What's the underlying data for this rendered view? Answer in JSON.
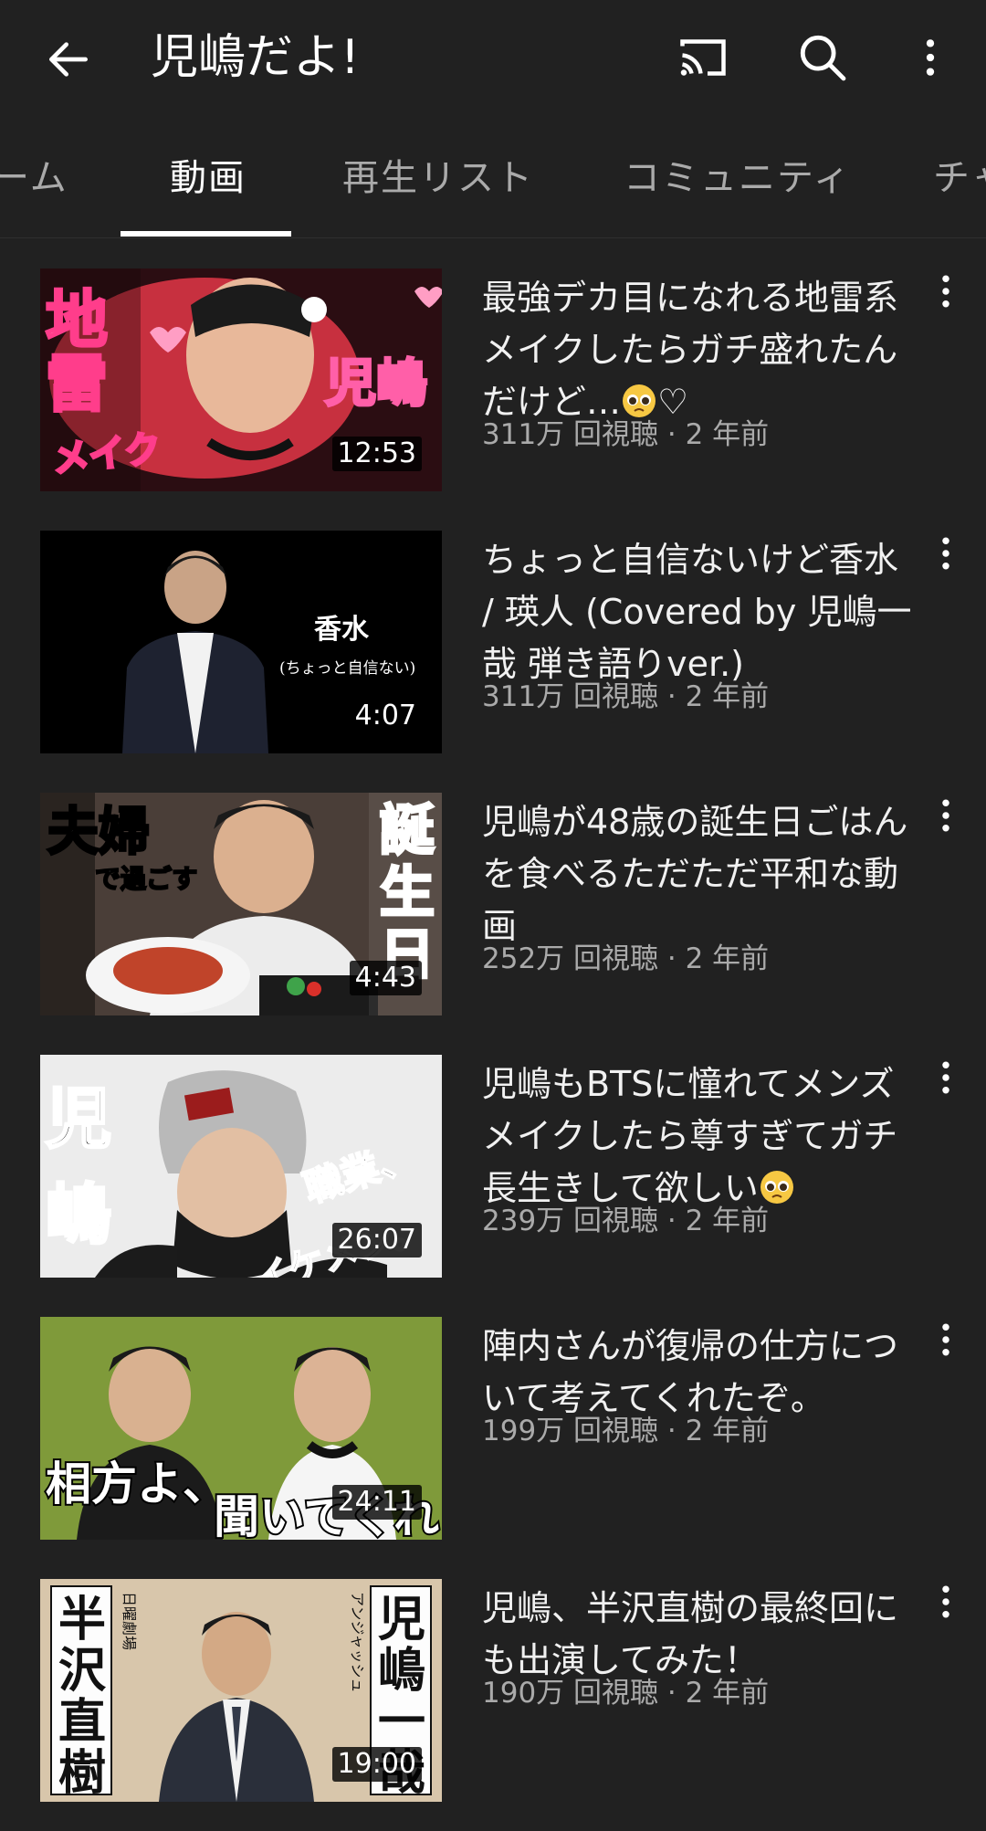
{
  "header": {
    "title": "児嶋だよ!",
    "icons": [
      "back-arrow-icon",
      "cast-icon",
      "search-icon",
      "more-vert-icon"
    ]
  },
  "tabs": [
    {
      "label": "ーム",
      "active": false
    },
    {
      "label": "動画",
      "active": true
    },
    {
      "label": "再生リスト",
      "active": false
    },
    {
      "label": "コミュニティ",
      "active": false
    },
    {
      "label": "チャ",
      "active": false
    }
  ],
  "videos": [
    {
      "title": "最強デカ目になれる地雷系メイクしたらガチ盛れたんだけど…",
      "title_suffix": "♡",
      "has_emoji": true,
      "views": "311万 回視聴",
      "age": "2 年前",
      "duration": "12:53"
    },
    {
      "title": "ちょっと自信ないけど香水 / 瑛人 (Covered by 児嶋一哉 弾き語りver.)",
      "title_suffix": "",
      "has_emoji": false,
      "views": "311万 回視聴",
      "age": "2 年前",
      "duration": "4:07"
    },
    {
      "title": "児嶋が48歳の誕生日ごはんを食べるただただ平和な動画",
      "title_suffix": "",
      "has_emoji": false,
      "views": "252万 回視聴",
      "age": "2 年前",
      "duration": "4:43"
    },
    {
      "title": "児嶋もBTSに憧れてメンズメイクしたら尊すぎてガチ長生きして欲しい",
      "title_suffix": "",
      "has_emoji": true,
      "views": "239万 回視聴",
      "age": "2 年前",
      "duration": "26:07"
    },
    {
      "title": "陣内さんが復帰の仕方について考えてくれたぞ。",
      "title_suffix": "",
      "has_emoji": false,
      "views": "199万 回視聴",
      "age": "2 年前",
      "duration": "24:11"
    },
    {
      "title": "児嶋、半沢直樹の最終回にも出演してみた！",
      "title_suffix": "",
      "has_emoji": false,
      "views": "190万 回視聴",
      "age": "2 年前",
      "duration": "19:00"
    }
  ],
  "thumbnails": [
    {
      "texts": [
        "地",
        "雷",
        "メイク",
        "児嶋"
      ]
    },
    {
      "texts": [
        "香水",
        "(ちょっと自信ない)"
      ]
    },
    {
      "texts": [
        "夫婦",
        "で過ごす",
        "誕",
        "生",
        "日"
      ]
    },
    {
      "texts": [
        "児",
        "嶋",
        "職業、",
        "イケメン。"
      ]
    },
    {
      "texts": [
        "相方よ、",
        "聞いてくれ"
      ]
    },
    {
      "texts": [
        "半",
        "沢",
        "直",
        "樹",
        "日曜劇場",
        "児",
        "嶋",
        "一",
        "哉",
        "アンジャッシュ"
      ]
    }
  ],
  "colors": {
    "background": "#212121",
    "text_primary": "#f1f1f1",
    "text_secondary": "#aaaaaa",
    "tab_indicator": "#ffffff"
  }
}
